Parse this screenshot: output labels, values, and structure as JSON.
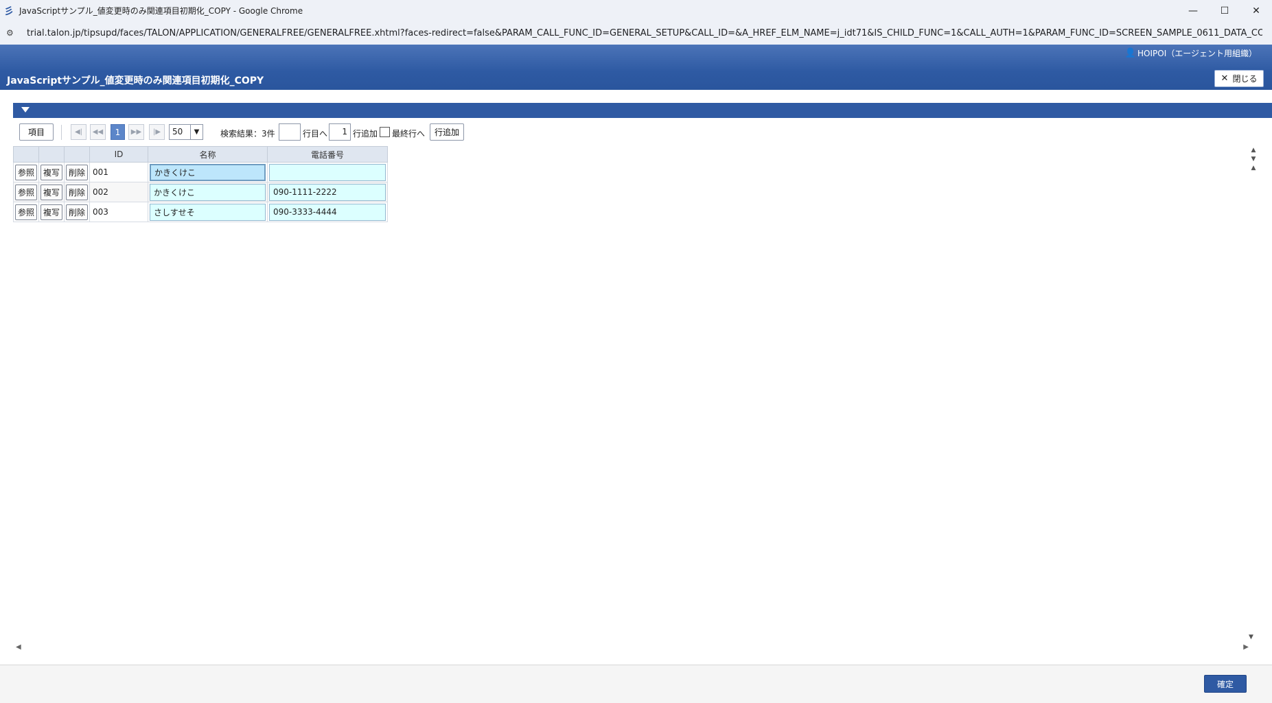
{
  "window": {
    "title": "JavaScriptサンプル_値変更時のみ関連項目初期化_COPY - Google Chrome",
    "url": "trial.talon.jp/tipsupd/faces/TALON/APPLICATION/GENERALFREE/GENERALFREE.xhtml?faces-redirect=false&PARAM_CALL_FUNC_ID=GENERAL_SETUP&CALL_ID=&A_HREF_ELM_NAME=j_idt71&IS_CHILD_FUNC=1&CALL_AUTH=1&PARAM_FUNC_ID=SCREEN_SAMPLE_0611_DATA_COPY&INI..."
  },
  "header": {
    "user": "HOIPOI（エージェント用組織）",
    "page_title": "JavaScriptサンプル_値変更時のみ関連項目初期化_COPY",
    "close_label": "閉じる"
  },
  "toolbar": {
    "items_label": "項目",
    "current_page": "1",
    "page_size": "50",
    "result_text": "検索結果：3件",
    "row_target_label": "行目へ",
    "add_count": "1",
    "add_count_label": "行追加",
    "last_row_label": "最終行へ",
    "add_row_button": "行追加"
  },
  "grid": {
    "columns": [
      "",
      "",
      "",
      "ID",
      "名称",
      "電話番号"
    ],
    "ref_label": "参照",
    "copy_label": "複写",
    "delete_label": "削除",
    "rows": [
      {
        "id": "001",
        "name": "かきくけこ",
        "phone": ""
      },
      {
        "id": "002",
        "name": "かきくけこ",
        "phone": "090-1111-2222"
      },
      {
        "id": "003",
        "name": "さしすせそ",
        "phone": "090-3333-4444"
      }
    ]
  },
  "footer": {
    "confirm_label": "確定"
  },
  "colors": {
    "header_blue": "#2e5aa3",
    "cell_input_bg": "#dcffff",
    "active_page": "#5c86c9"
  }
}
